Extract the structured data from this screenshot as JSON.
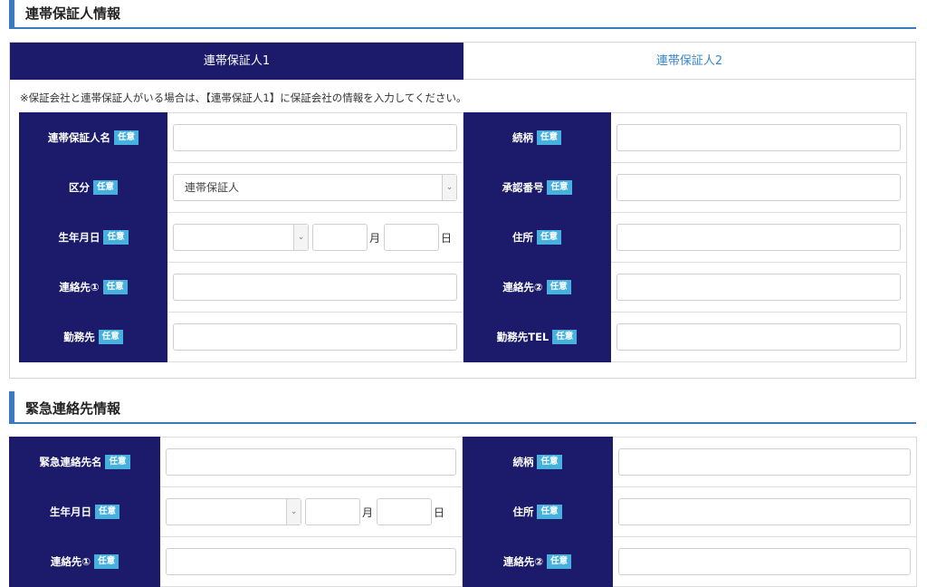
{
  "section1": {
    "title": "連帯保証人情報",
    "tabs": [
      "連帯保証人1",
      "連帯保証人2"
    ],
    "note": "※保証会社と連帯保証人がいる場合は、【連帯保証人1】に保証会社の情報を入力してください。",
    "badge": "任意",
    "rows": [
      {
        "left_label": "連帯保証人名",
        "right_label": "続柄"
      },
      {
        "left_label": "区分",
        "left_select_value": "連帯保証人",
        "right_label": "承認番号"
      },
      {
        "left_label": "生年月日",
        "right_label": "住所"
      },
      {
        "left_label": "連絡先①",
        "right_label": "連絡先②"
      },
      {
        "left_label": "勤務先",
        "right_label": "勤務先TEL"
      }
    ]
  },
  "section2": {
    "title": "緊急連絡先情報",
    "badge": "任意",
    "rows": [
      {
        "left_label": "緊急連絡先名",
        "right_label": "続柄"
      },
      {
        "left_label": "生年月日",
        "right_label": "住所"
      },
      {
        "left_label": "連絡先①",
        "right_label": "連絡先②"
      }
    ]
  },
  "date_units": {
    "month": "月",
    "day": "日"
  },
  "icons": {
    "select_arrow": "chevron-down-icon"
  },
  "colors": {
    "label_bg": "#1b1a6b",
    "badge_bg": "#46b1de",
    "accent": "#3a7bbf",
    "tab_inactive_text": "#3a86c8"
  }
}
